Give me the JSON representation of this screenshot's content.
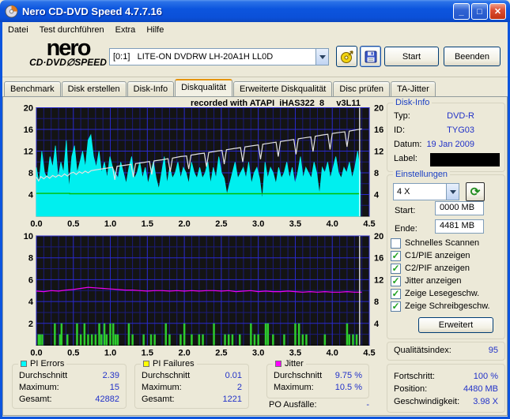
{
  "window": {
    "title": "Nero CD-DVD Speed 4.7.7.16"
  },
  "titlebar_buttons": {
    "minimize": "_",
    "maximize": "□",
    "close": "✕"
  },
  "menu": {
    "items": [
      "Datei",
      "Test durchführen",
      "Extra",
      "Hilfe"
    ]
  },
  "toolbar": {
    "logo_line1": "nero",
    "logo_line2": "CD·DVD∅SPEED",
    "drive": "[0:1]   LITE-ON DVDRW LH-20A1H LL0D",
    "start_label": "Start",
    "quit_label": "Beenden"
  },
  "tabs": {
    "items": [
      "Benchmark",
      "Disk erstellen",
      "Disk-Info",
      "Diskqualität",
      "Erweiterte Diskqualität",
      "Disc prüfen",
      "TA-Jitter"
    ],
    "active": "Diskqualität"
  },
  "chart_header": "recorded with ATAPI  iHAS322  8     v3L11",
  "chart_data": [
    {
      "type": "area",
      "title": "recorded with ATAPI iHAS322 8 v3L11",
      "xlabel": "GB",
      "ylabel": "PI Errors / Speed",
      "xlim": [
        0,
        4.5
      ],
      "x_minor": 0.1,
      "x_major": 0.5,
      "ylim_left": [
        0,
        20
      ],
      "y_minor": 2,
      "y_major": 4,
      "ylim_right": [
        0,
        20
      ],
      "x_ticks": [
        "0.0",
        "0.5",
        "1.0",
        "1.5",
        "2.0",
        "2.5",
        "3.0",
        "3.5",
        "4.0",
        "4.5"
      ],
      "left_ticks": [
        "4",
        "8",
        "12",
        "16",
        "20"
      ],
      "right_ticks": [
        "4",
        "8",
        "12",
        "16",
        "20"
      ],
      "bg": "#141414",
      "grid_minor": "#1B1B7A",
      "grid_major": "#2A2ACF",
      "cursor_x": 4.37,
      "series": [
        {
          "name": "PI Errors",
          "type": "area",
          "color": "#00EFEF",
          "x_start": 0,
          "x_step": 0.0368,
          "values": [
            9,
            6,
            12,
            8,
            7,
            11,
            9,
            13,
            7,
            10,
            8,
            14,
            5,
            11,
            13,
            8,
            10,
            12,
            9,
            14,
            15,
            11,
            9,
            12,
            8,
            10,
            7,
            11,
            9,
            8,
            7,
            10,
            8,
            6,
            9,
            11,
            7,
            8,
            10,
            7,
            9,
            6,
            8,
            10,
            7,
            5,
            8,
            11,
            6,
            9,
            7,
            8,
            10,
            7,
            9,
            8,
            6,
            10,
            8,
            7,
            9,
            7,
            8,
            10,
            6,
            9,
            7,
            11,
            8,
            7,
            4,
            6,
            8,
            10,
            7,
            8,
            9,
            7,
            10,
            6,
            8,
            9,
            7,
            3,
            10,
            7,
            9,
            8,
            6,
            9,
            7,
            8,
            10,
            7,
            9,
            6,
            8,
            11,
            7,
            9,
            8,
            7,
            10,
            8,
            4,
            9,
            8,
            10,
            7,
            9,
            11,
            8,
            7,
            9,
            8,
            10,
            7,
            9,
            12,
            8
          ]
        },
        {
          "name": "Schreibgeschwindigkeit",
          "type": "line",
          "color": "#E2E2E2",
          "width": 1.2,
          "points": [
            [
              0,
              7.2
            ],
            [
              0.03,
              6.5
            ],
            [
              0.06,
              7.3
            ],
            [
              0.1,
              6.9
            ],
            [
              0.14,
              7.4
            ],
            [
              0.18,
              7.0
            ],
            [
              0.22,
              7.5
            ],
            [
              0.26,
              7.2
            ],
            [
              0.3,
              7.6
            ],
            [
              0.34,
              7.3
            ],
            [
              0.38,
              7.8
            ],
            [
              0.42,
              7.4
            ],
            [
              0.46,
              7.9
            ],
            [
              0.5,
              8.1
            ],
            [
              0.54,
              7.7
            ],
            [
              0.58,
              8.2
            ],
            [
              0.62,
              7.9
            ],
            [
              0.66,
              8.3
            ],
            [
              0.7,
              8.0
            ],
            [
              0.74,
              8.4
            ],
            [
              0.78,
              8.5
            ],
            [
              1.03,
              9.04
            ],
            [
              1.06,
              6.7
            ],
            [
              1.09,
              9.2
            ],
            [
              1.2,
              9.4
            ],
            [
              1.28,
              9.56
            ],
            [
              1.31,
              7.2
            ],
            [
              1.34,
              9.7
            ],
            [
              1.45,
              9.9
            ],
            [
              1.53,
              10.08
            ],
            [
              1.56,
              7.7
            ],
            [
              1.59,
              10.2
            ],
            [
              1.7,
              10.4
            ],
            [
              1.78,
              10.6
            ],
            [
              1.81,
              8.2
            ],
            [
              1.84,
              10.7
            ],
            [
              1.95,
              11.0
            ],
            [
              2.03,
              11.12
            ],
            [
              2.06,
              8.7
            ],
            [
              2.09,
              11.25
            ],
            [
              2.2,
              11.5
            ],
            [
              2.27,
              11.62
            ],
            [
              2.3,
              9.1
            ],
            [
              2.33,
              11.75
            ],
            [
              2.44,
              12.0
            ],
            [
              2.51,
              12.12
            ],
            [
              2.54,
              9.6
            ],
            [
              2.57,
              12.25
            ],
            [
              2.68,
              12.5
            ],
            [
              2.76,
              12.64
            ],
            [
              2.79,
              10.0
            ],
            [
              2.82,
              12.77
            ],
            [
              2.93,
              13.0
            ],
            [
              3.0,
              13.14
            ],
            [
              3.03,
              10.5
            ],
            [
              3.06,
              13.27
            ],
            [
              3.17,
              13.5
            ],
            [
              3.24,
              13.64
            ],
            [
              3.27,
              11.0
            ],
            [
              3.3,
              13.77
            ],
            [
              3.41,
              14.0
            ],
            [
              3.48,
              14.14
            ],
            [
              3.51,
              11.4
            ],
            [
              3.54,
              14.27
            ],
            [
              3.65,
              14.5
            ],
            [
              3.71,
              14.62
            ],
            [
              3.74,
              11.9
            ],
            [
              3.77,
              14.75
            ],
            [
              3.88,
              15.0
            ],
            [
              3.94,
              15.1
            ],
            [
              3.97,
              12.3
            ],
            [
              4.0,
              15.25
            ],
            [
              4.1,
              15.45
            ],
            [
              4.17,
              15.57
            ],
            [
              4.2,
              12.8
            ],
            [
              4.23,
              15.7
            ],
            [
              4.34,
              15.95
            ],
            [
              4.4,
              16.1
            ]
          ]
        },
        {
          "name": "Lesegeschwindigkeit",
          "type": "line",
          "color": "#00BE00",
          "width": 1.4,
          "points": [
            [
              0,
              4.2
            ],
            [
              0.45,
              4.2
            ],
            [
              0.45,
              4.15
            ],
            [
              4.37,
              4.15
            ]
          ]
        }
      ]
    },
    {
      "type": "bar",
      "title": "PI Failures / Jitter",
      "xlabel": "GB",
      "ylabel": "PI Failures / Jitter",
      "xlim": [
        0,
        4.5
      ],
      "x_minor": 0.1,
      "x_major": 0.5,
      "ylim_left": [
        0,
        10
      ],
      "y_minor": 1,
      "y_major": 2,
      "ylim_right": [
        0,
        20
      ],
      "x_ticks": [
        "0.0",
        "0.5",
        "1.0",
        "1.5",
        "2.0",
        "2.5",
        "3.0",
        "3.5",
        "4.0",
        "4.5"
      ],
      "left_ticks": [
        "2",
        "4",
        "6",
        "8",
        "10"
      ],
      "right_ticks": [
        "4",
        "8",
        "12",
        "16",
        "20"
      ],
      "bg": "#141414",
      "grid_minor": "#1B1B7A",
      "grid_major": "#2A2ACF",
      "cursor_x": 4.37,
      "series": [
        {
          "name": "PI Failures",
          "type": "bars",
          "color": "#2ECC2E",
          "bars": [
            [
              0.03,
              1
            ],
            [
              0.05,
              1
            ],
            [
              0.08,
              1
            ],
            [
              0.25,
              2
            ],
            [
              0.32,
              1
            ],
            [
              0.34,
              2
            ],
            [
              0.42,
              1
            ],
            [
              0.55,
              2
            ],
            [
              0.6,
              1
            ],
            [
              0.65,
              2
            ],
            [
              0.7,
              1
            ],
            [
              0.75,
              1
            ],
            [
              0.8,
              1
            ],
            [
              0.85,
              2
            ],
            [
              0.88,
              1
            ],
            [
              0.92,
              2
            ],
            [
              0.95,
              1
            ],
            [
              1.0,
              2
            ],
            [
              1.04,
              2
            ],
            [
              1.07,
              1
            ],
            [
              1.1,
              1
            ],
            [
              1.25,
              2
            ],
            [
              1.3,
              1
            ],
            [
              1.45,
              1
            ],
            [
              1.55,
              1
            ],
            [
              1.6,
              1
            ],
            [
              1.75,
              2
            ],
            [
              1.8,
              1
            ],
            [
              1.95,
              1
            ],
            [
              2.0,
              2
            ],
            [
              2.1,
              1
            ],
            [
              2.2,
              1
            ],
            [
              2.25,
              1
            ],
            [
              2.4,
              2
            ],
            [
              2.55,
              1
            ],
            [
              2.6,
              1
            ],
            [
              2.65,
              1
            ],
            [
              2.75,
              1
            ],
            [
              2.9,
              2
            ],
            [
              2.95,
              1
            ],
            [
              3.0,
              1
            ],
            [
              3.1,
              2
            ],
            [
              3.13,
              2
            ],
            [
              3.2,
              1
            ],
            [
              3.35,
              1
            ],
            [
              3.5,
              2
            ],
            [
              3.55,
              2
            ],
            [
              3.6,
              1
            ],
            [
              3.65,
              1
            ],
            [
              3.9,
              1
            ],
            [
              4.2,
              2
            ],
            [
              4.23,
              1
            ],
            [
              4.28,
              1
            ],
            [
              4.33,
              1
            ]
          ]
        },
        {
          "name": "Jitter",
          "type": "line",
          "color": "#F000F0",
          "width": 1.2,
          "x_start": 0,
          "x_step": 0.1,
          "values": [
            4.95,
            4.9,
            5.0,
            4.95,
            5.05,
            5.1,
            5.2,
            5.3,
            5.25,
            5.2,
            5.15,
            5.1,
            5.05,
            5.05,
            5.0,
            4.95,
            5.0,
            5.0,
            4.95,
            5.0,
            4.95,
            5.0,
            4.95,
            5.0,
            5.0,
            4.95,
            5.0,
            4.9,
            4.95,
            5.0,
            4.9,
            4.95,
            4.9,
            4.9,
            4.95,
            4.9,
            4.85,
            4.9,
            4.85,
            4.9,
            4.85,
            4.85,
            4.9,
            4.85,
            4.85
          ]
        }
      ]
    }
  ],
  "disk_info": {
    "title": "Disk-Info",
    "rows": [
      {
        "label": "Typ:",
        "value": "DVD-R"
      },
      {
        "label": "ID:",
        "value": "TYG03"
      },
      {
        "label": "Datum:",
        "value": "19 Jan 2009"
      },
      {
        "label": "Label:",
        "value": ""
      }
    ]
  },
  "settings": {
    "title": "Einstellungen",
    "speed": "4 X",
    "refresh_icon": "⟳",
    "start_label": "Start:",
    "start_value": "0000 MB",
    "end_label": "Ende:",
    "end_value": "4481 MB",
    "checkboxes": [
      {
        "label": "Schnelles Scannen",
        "checked": false
      },
      {
        "label": "C1/PIE anzeigen",
        "checked": true
      },
      {
        "label": "C2/PIF anzeigen",
        "checked": true
      },
      {
        "label": "Jitter anzeigen",
        "checked": true
      },
      {
        "label": "Zeige Lesegeschw.",
        "checked": true
      },
      {
        "label": "Zeige Schreibgeschw.",
        "checked": true
      }
    ],
    "advanced_label": "Erweitert"
  },
  "quality": {
    "label": "Qualitätsindex:",
    "value": "95"
  },
  "progress": {
    "rows": [
      {
        "label": "Fortschritt:",
        "value": "100 %"
      },
      {
        "label": "Position:",
        "value": "4480 MB"
      },
      {
        "label": "Geschwindigkeit:",
        "value": "3.98 X"
      }
    ]
  },
  "stats": [
    {
      "id": "pi-errors",
      "title": "PI Errors",
      "swatch": "#00FFFF",
      "rows": [
        {
          "label": "Durchschnitt",
          "value": "2.39"
        },
        {
          "label": "Maximum:",
          "value": "15"
        },
        {
          "label": "Gesamt:",
          "value": "42882"
        }
      ]
    },
    {
      "id": "pi-failures",
      "title": "PI Failures",
      "swatch": "#FFFF00",
      "rows": [
        {
          "label": "Durchschnitt",
          "value": "0.01"
        },
        {
          "label": "Maximum:",
          "value": "2"
        },
        {
          "label": "Gesamt:",
          "value": "1221"
        }
      ]
    },
    {
      "id": "jitter",
      "title": "Jitter",
      "swatch": "#FF00FF",
      "rows": [
        {
          "label": "Durchschnitt",
          "value": "9.75 %"
        },
        {
          "label": "Maximum:",
          "value": "10.5 %"
        }
      ]
    }
  ],
  "po_failures": {
    "label": "PO Ausfälle:",
    "value": "-"
  }
}
